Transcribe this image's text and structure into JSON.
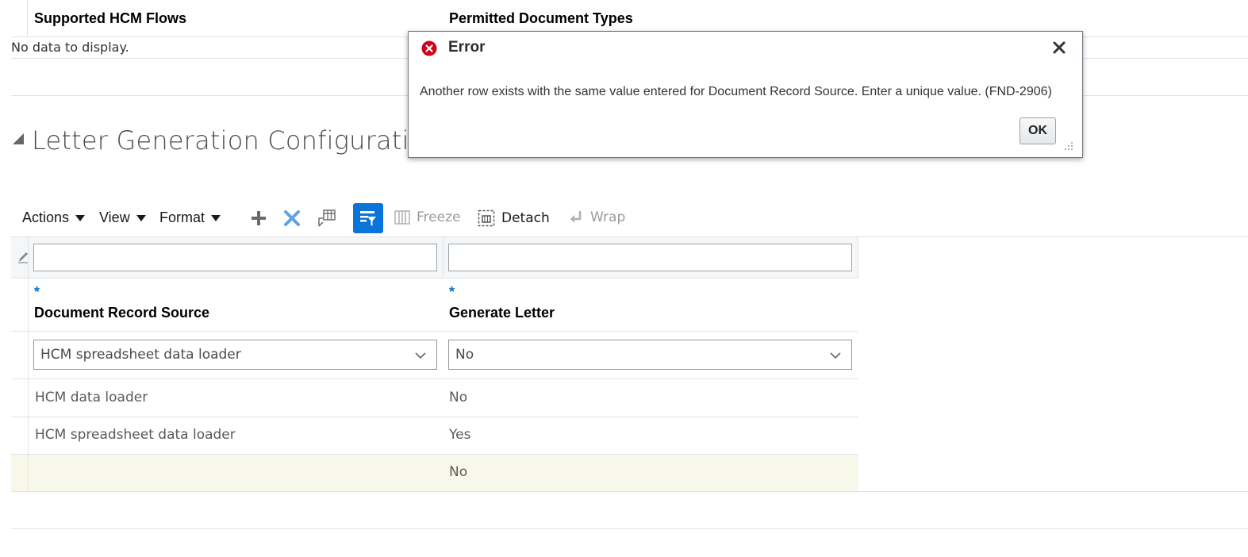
{
  "top_table": {
    "col1_header": "Supported HCM Flows",
    "col2_header": "Permitted Document Types",
    "empty_text": "No data to display."
  },
  "section": {
    "title": "Letter Generation Configuration"
  },
  "toolbar": {
    "actions": "Actions",
    "view": "View",
    "format": "Format",
    "freeze": "Freeze",
    "detach": "Detach",
    "wrap": "Wrap"
  },
  "table": {
    "required_mark": "*",
    "col1_header": "Document Record Source",
    "col2_header": "Generate Letter",
    "edit_row": {
      "source_value": "HCM spreadsheet data loader",
      "generate_value": "No"
    },
    "rows": [
      {
        "source": "HCM data loader",
        "generate": "No"
      },
      {
        "source": "HCM spreadsheet data loader",
        "generate": "Yes"
      },
      {
        "source": "",
        "generate": "No"
      }
    ]
  },
  "dialog": {
    "title": "Error",
    "message": "Another row exists with the same value entered for Document Record Source. Enter a unique value. (FND-2906)",
    "ok_label": "OK"
  },
  "colors": {
    "accent": "#0b74d8",
    "error": "#d0021b",
    "selected_row": "#f8f8ea"
  }
}
